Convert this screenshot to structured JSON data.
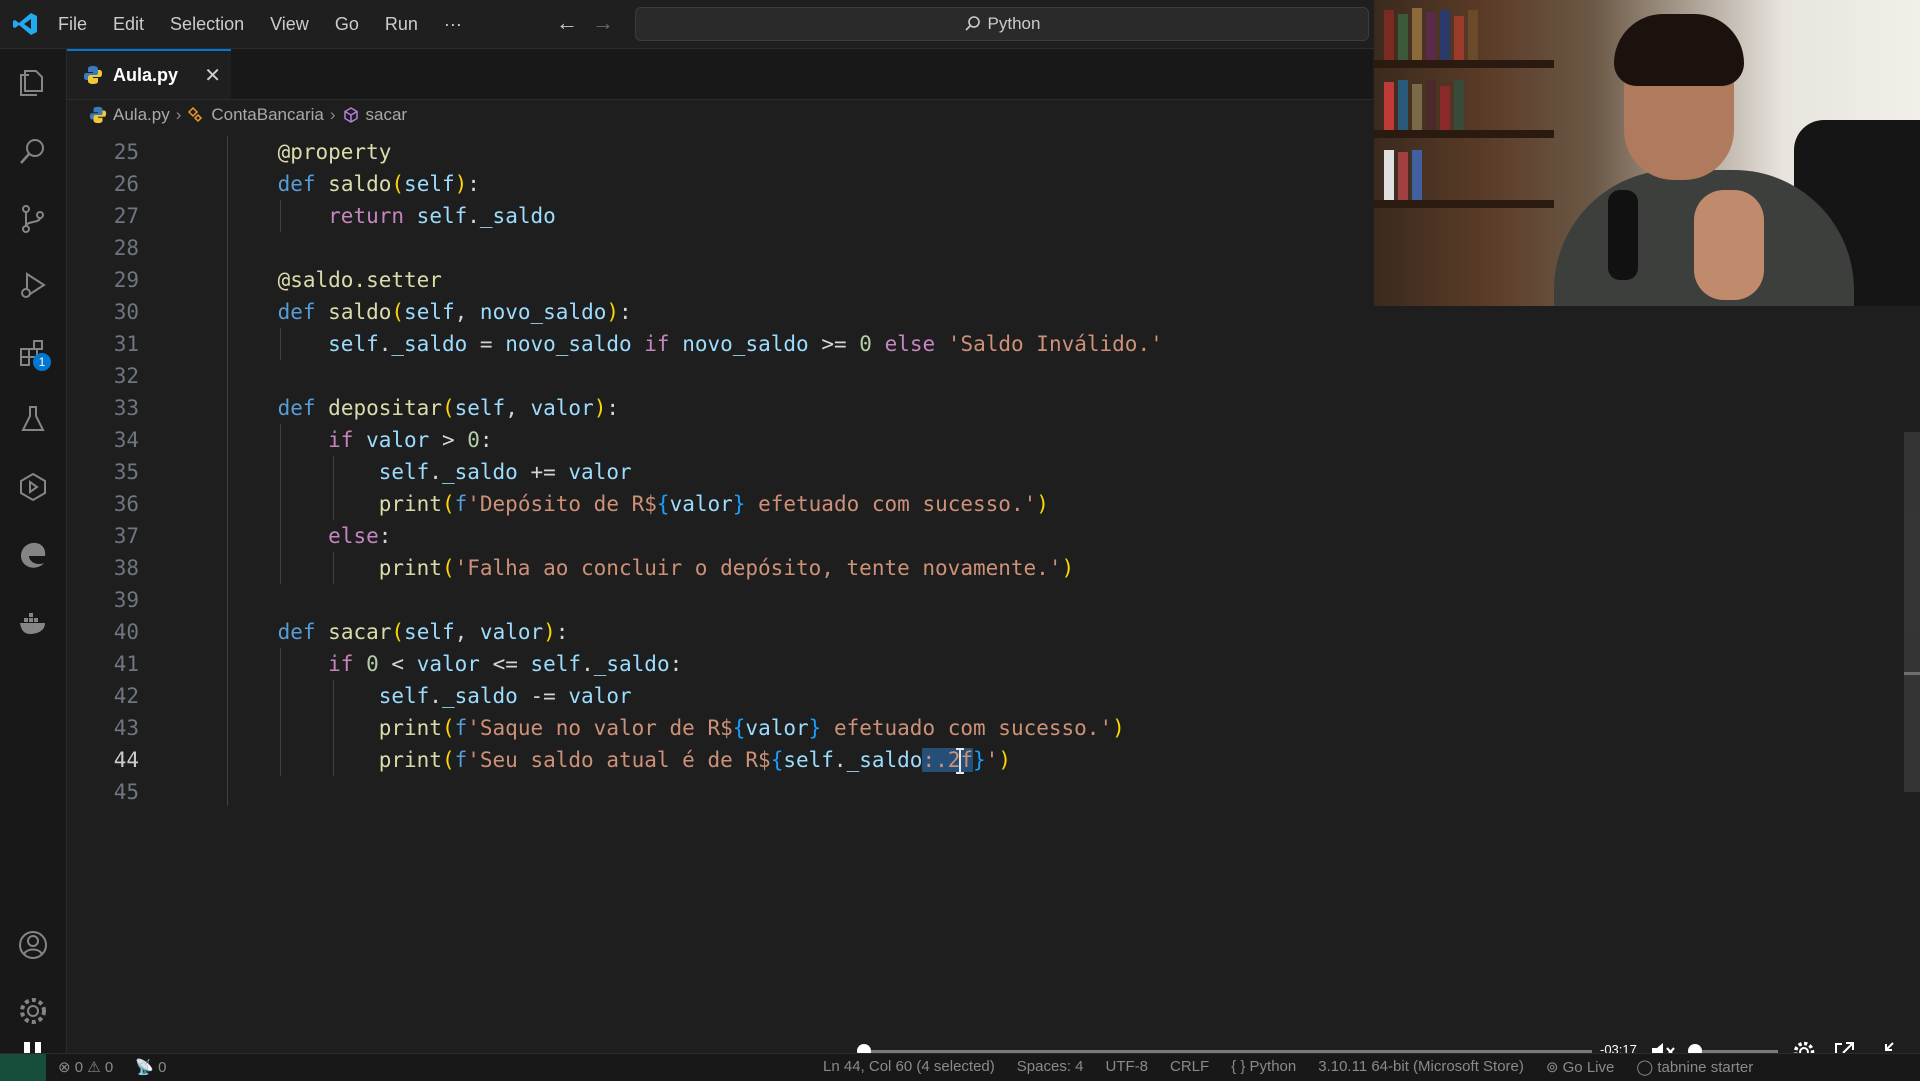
{
  "menu": {
    "items": [
      "File",
      "Edit",
      "Selection",
      "View",
      "Go",
      "Run",
      "···"
    ]
  },
  "command_center": {
    "label": "Python"
  },
  "tab": {
    "name": "Aula.py",
    "close": "✕"
  },
  "breadcrumb": {
    "file": "Aula.py",
    "class": "ContaBancaria",
    "method": "sacar"
  },
  "activity_badge": "1",
  "editor": {
    "line_numbers": [
      "25",
      "26",
      "27",
      "28",
      "29",
      "30",
      "31",
      "32",
      "33",
      "34",
      "35",
      "36",
      "37",
      "38",
      "39",
      "40",
      "41",
      "42",
      "43",
      "44",
      "45"
    ],
    "active_line": "44"
  },
  "video": {
    "time": "-03:17",
    "progress": 0.0
  },
  "status": {
    "errors": "0",
    "warnings": "0",
    "ports": "0",
    "position": "Ln 44, Col 60 (4 selected)",
    "spaces": "Spaces: 4",
    "encoding": "UTF-8",
    "eol": "CRLF",
    "language": "Python",
    "interpreter": "3.10.11 64-bit (Microsoft Store)",
    "go_live": "Go Live",
    "tabnine": "tabnine starter"
  },
  "colors": {
    "accent": "#0078d4",
    "keyword": "#569cd6",
    "string": "#ce9178",
    "function": "#dcdcaa",
    "variable": "#9cdcfe",
    "selection": "#264f78"
  }
}
